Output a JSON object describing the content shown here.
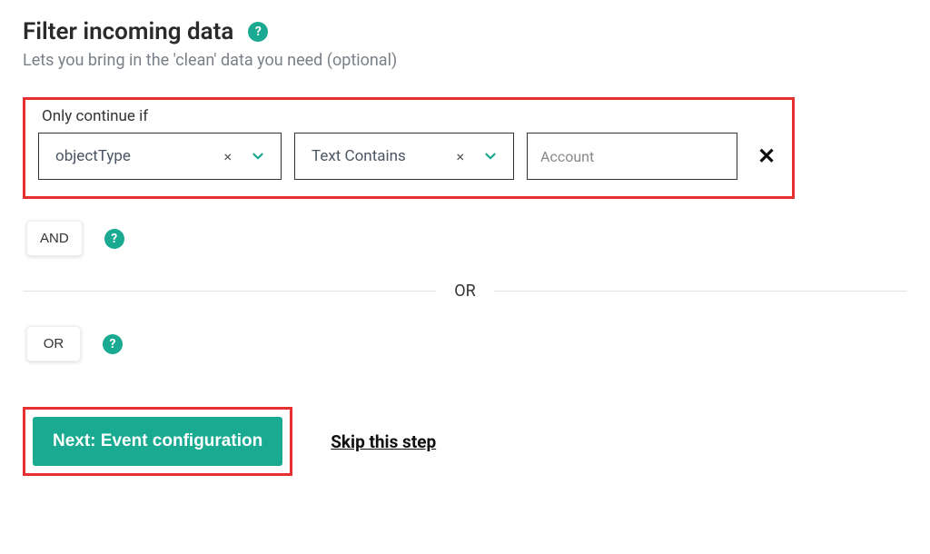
{
  "header": {
    "title": "Filter incoming data",
    "subtitle": "Lets you bring in the 'clean' data you need (optional)",
    "help_icon": "?"
  },
  "filter": {
    "label": "Only continue if",
    "field_value": "objectType",
    "condition_value": "Text Contains",
    "input_value": "Account",
    "clear_icon": "×",
    "row_delete_icon": "✕"
  },
  "conditions": {
    "and_label": "AND",
    "or_label": "OR",
    "help_icon": "?",
    "divider_text": "OR"
  },
  "footer": {
    "next_label": "Next: Event configuration",
    "skip_label": "Skip this step"
  }
}
